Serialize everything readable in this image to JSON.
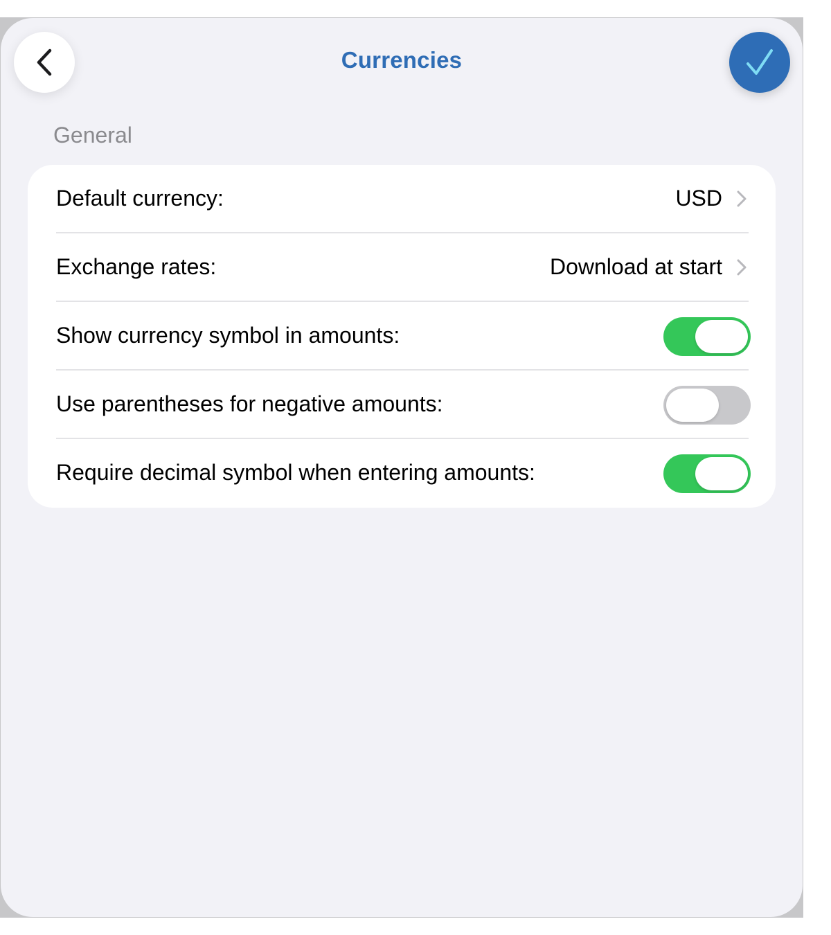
{
  "nav": {
    "title": "Currencies",
    "back_icon": "chevron-left-icon",
    "done_icon": "checkmark-icon",
    "accent_color": "#2f6db5"
  },
  "section": {
    "header": "General"
  },
  "rows": [
    {
      "label": "Default currency:",
      "value": "USD",
      "type": "disclosure"
    },
    {
      "label": "Exchange rates:",
      "value": "Download at start",
      "type": "disclosure"
    },
    {
      "label": "Show currency symbol in amounts:",
      "type": "toggle",
      "on": true
    },
    {
      "label": "Use parentheses for negative amounts:",
      "type": "toggle",
      "on": false
    },
    {
      "label": "Require decimal symbol when entering amounts:",
      "type": "toggle",
      "on": true
    }
  ],
  "colors": {
    "toggle_on": "#34c759",
    "toggle_off": "#c8c8cb",
    "background": "#f2f2f7"
  }
}
